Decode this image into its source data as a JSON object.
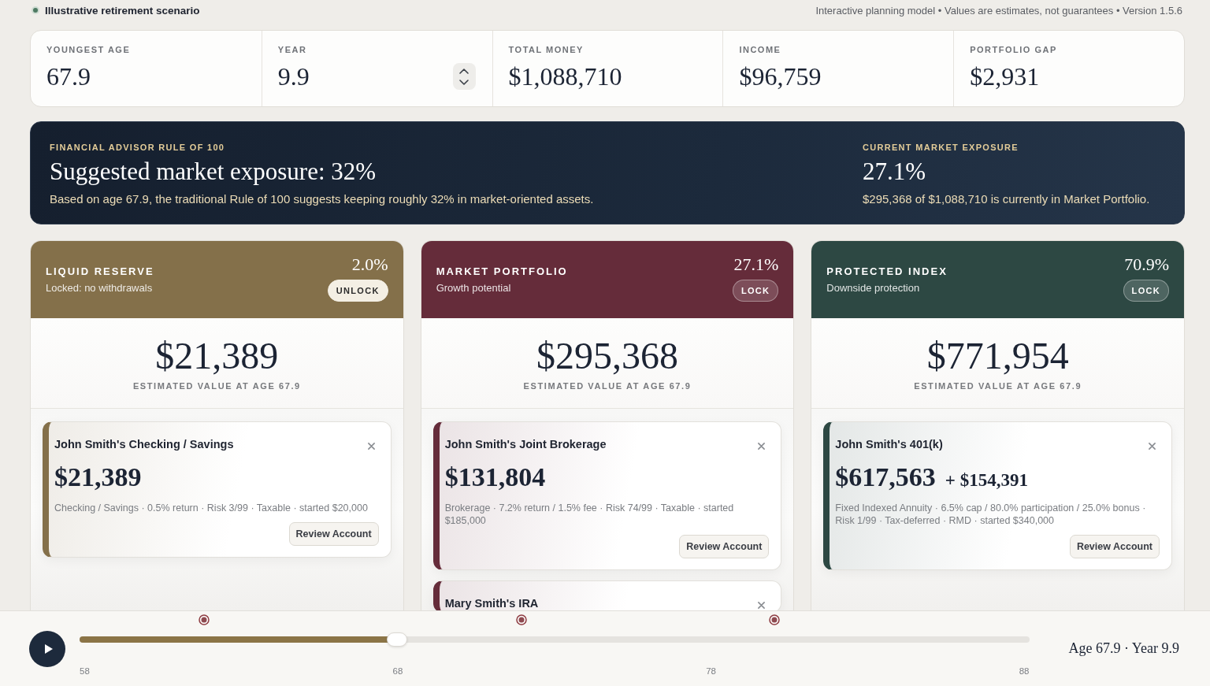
{
  "header": {
    "scenario": "Illustrative retirement scenario",
    "meta": "Interactive planning model • Values are estimates, not guarantees • Version 1.5.6"
  },
  "stats": [
    {
      "label": "YOUNGEST AGE",
      "value": "67.9",
      "kind": "plain"
    },
    {
      "label": "YEAR",
      "value": "9.9",
      "kind": "stepper"
    },
    {
      "label": "TOTAL MONEY",
      "value": "$1,088,710",
      "kind": "plain"
    },
    {
      "label": "INCOME",
      "value": "$96,759",
      "kind": "plain"
    },
    {
      "label": "PORTFOLIO GAP",
      "value": "$2,931",
      "kind": "plain"
    }
  ],
  "banner": {
    "label": "FINANCIAL ADVISOR RULE OF 100",
    "heading": "Suggested market exposure: 32%",
    "text": "Based on age 67.9, the traditional Rule of 100 suggests keeping roughly 32% in market-oriented assets.",
    "exposure": {
      "label": "CURRENT MARKET EXPOSURE",
      "value": "27.1%",
      "text": "$295,368 of $1,088,710 is currently in Market Portfolio."
    }
  },
  "columns": [
    {
      "title": "LIQUID RESERVE",
      "subtitle": "Locked: no withdrawals",
      "share": "2.0%",
      "color": "#84704a",
      "locked": true,
      "lock_label": "UNLOCK",
      "total": "$21,389",
      "total_label": "ESTIMATED VALUE AT AGE 67.9",
      "accounts": [
        {
          "name": "John Smith's Checking / Savings",
          "value": "$21,389",
          "details": "Checking / Savings · 0.5% return · Risk 3/99 · Taxable · started $20,000",
          "action": "Review Account"
        }
      ]
    },
    {
      "title": "MARKET PORTFOLIO",
      "subtitle": "Growth potential",
      "share": "27.1%",
      "color": "#652c3a",
      "locked": false,
      "lock_label": "LOCK",
      "total": "$295,368",
      "total_label": "ESTIMATED VALUE AT AGE 67.9",
      "accounts": [
        {
          "name": "John Smith's Joint Brokerage",
          "value": "$131,804",
          "details": "Brokerage · 7.2% return / 1.5% fee · Risk 74/99 · Taxable · started $185,000",
          "action": "Review Account"
        },
        {
          "name": "Mary Smith's IRA"
        }
      ]
    },
    {
      "title": "PROTECTED INDEX",
      "subtitle": "Downside protection",
      "share": "70.9%",
      "color": "#2d4843",
      "locked": false,
      "lock_label": "LOCK",
      "total": "$771,954",
      "total_label": "ESTIMATED VALUE AT AGE 67.9",
      "accounts": [
        {
          "name": "John Smith's 401(k)",
          "value": "$617,563",
          "bonus": "+ $154,391",
          "details": "Fixed Indexed Annuity · 6.5% cap / 80.0% participation / 25.0% bonus · Risk 1/99 · Tax-deferred · RMD · started $340,000",
          "action": "Review Account"
        }
      ]
    }
  ],
  "timeline": {
    "level": 0.334,
    "markers": [
      {
        "level": 0.131
      },
      {
        "level": 0.465
      },
      {
        "level": 0.732
      }
    ],
    "ticks": [
      "58",
      "68",
      "78",
      "88"
    ],
    "readout": "Age 67.9 · Year 9.9"
  }
}
